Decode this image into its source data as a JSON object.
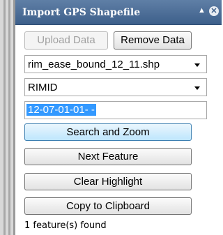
{
  "panel": {
    "title": "Import GPS Shapefile",
    "collapse_glyph": "▲",
    "close_glyph": "✕"
  },
  "buttons": {
    "upload": "Upload Data",
    "remove": "Remove Data",
    "search_zoom": "Search and Zoom",
    "next_feature": "Next Feature",
    "clear_highlight": "Clear Highlight",
    "copy_clipboard": "Copy to Clipboard"
  },
  "selects": {
    "file": {
      "value": "rim_ease_bound_12_11.shp"
    },
    "field": {
      "value": "RIMID"
    }
  },
  "search": {
    "value": "12-07-01-01- -"
  },
  "status": {
    "text": "1 feature(s) found"
  },
  "colors": {
    "title_bar": "#4a6c96",
    "selection": "#3399ff"
  }
}
